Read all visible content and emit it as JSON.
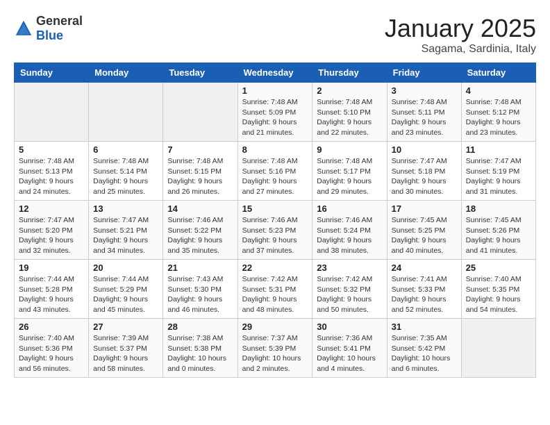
{
  "logo": {
    "text_general": "General",
    "text_blue": "Blue"
  },
  "title": {
    "month": "January 2025",
    "location": "Sagama, Sardinia, Italy"
  },
  "weekdays": [
    "Sunday",
    "Monday",
    "Tuesday",
    "Wednesday",
    "Thursday",
    "Friday",
    "Saturday"
  ],
  "weeks": [
    [
      {
        "day": "",
        "sunrise": "",
        "sunset": "",
        "daylight": ""
      },
      {
        "day": "",
        "sunrise": "",
        "sunset": "",
        "daylight": ""
      },
      {
        "day": "",
        "sunrise": "",
        "sunset": "",
        "daylight": ""
      },
      {
        "day": "1",
        "sunrise": "Sunrise: 7:48 AM",
        "sunset": "Sunset: 5:09 PM",
        "daylight": "Daylight: 9 hours and 21 minutes."
      },
      {
        "day": "2",
        "sunrise": "Sunrise: 7:48 AM",
        "sunset": "Sunset: 5:10 PM",
        "daylight": "Daylight: 9 hours and 22 minutes."
      },
      {
        "day": "3",
        "sunrise": "Sunrise: 7:48 AM",
        "sunset": "Sunset: 5:11 PM",
        "daylight": "Daylight: 9 hours and 23 minutes."
      },
      {
        "day": "4",
        "sunrise": "Sunrise: 7:48 AM",
        "sunset": "Sunset: 5:12 PM",
        "daylight": "Daylight: 9 hours and 23 minutes."
      }
    ],
    [
      {
        "day": "5",
        "sunrise": "Sunrise: 7:48 AM",
        "sunset": "Sunset: 5:13 PM",
        "daylight": "Daylight: 9 hours and 24 minutes."
      },
      {
        "day": "6",
        "sunrise": "Sunrise: 7:48 AM",
        "sunset": "Sunset: 5:14 PM",
        "daylight": "Daylight: 9 hours and 25 minutes."
      },
      {
        "day": "7",
        "sunrise": "Sunrise: 7:48 AM",
        "sunset": "Sunset: 5:15 PM",
        "daylight": "Daylight: 9 hours and 26 minutes."
      },
      {
        "day": "8",
        "sunrise": "Sunrise: 7:48 AM",
        "sunset": "Sunset: 5:16 PM",
        "daylight": "Daylight: 9 hours and 27 minutes."
      },
      {
        "day": "9",
        "sunrise": "Sunrise: 7:48 AM",
        "sunset": "Sunset: 5:17 PM",
        "daylight": "Daylight: 9 hours and 29 minutes."
      },
      {
        "day": "10",
        "sunrise": "Sunrise: 7:47 AM",
        "sunset": "Sunset: 5:18 PM",
        "daylight": "Daylight: 9 hours and 30 minutes."
      },
      {
        "day": "11",
        "sunrise": "Sunrise: 7:47 AM",
        "sunset": "Sunset: 5:19 PM",
        "daylight": "Daylight: 9 hours and 31 minutes."
      }
    ],
    [
      {
        "day": "12",
        "sunrise": "Sunrise: 7:47 AM",
        "sunset": "Sunset: 5:20 PM",
        "daylight": "Daylight: 9 hours and 32 minutes."
      },
      {
        "day": "13",
        "sunrise": "Sunrise: 7:47 AM",
        "sunset": "Sunset: 5:21 PM",
        "daylight": "Daylight: 9 hours and 34 minutes."
      },
      {
        "day": "14",
        "sunrise": "Sunrise: 7:46 AM",
        "sunset": "Sunset: 5:22 PM",
        "daylight": "Daylight: 9 hours and 35 minutes."
      },
      {
        "day": "15",
        "sunrise": "Sunrise: 7:46 AM",
        "sunset": "Sunset: 5:23 PM",
        "daylight": "Daylight: 9 hours and 37 minutes."
      },
      {
        "day": "16",
        "sunrise": "Sunrise: 7:46 AM",
        "sunset": "Sunset: 5:24 PM",
        "daylight": "Daylight: 9 hours and 38 minutes."
      },
      {
        "day": "17",
        "sunrise": "Sunrise: 7:45 AM",
        "sunset": "Sunset: 5:25 PM",
        "daylight": "Daylight: 9 hours and 40 minutes."
      },
      {
        "day": "18",
        "sunrise": "Sunrise: 7:45 AM",
        "sunset": "Sunset: 5:26 PM",
        "daylight": "Daylight: 9 hours and 41 minutes."
      }
    ],
    [
      {
        "day": "19",
        "sunrise": "Sunrise: 7:44 AM",
        "sunset": "Sunset: 5:28 PM",
        "daylight": "Daylight: 9 hours and 43 minutes."
      },
      {
        "day": "20",
        "sunrise": "Sunrise: 7:44 AM",
        "sunset": "Sunset: 5:29 PM",
        "daylight": "Daylight: 9 hours and 45 minutes."
      },
      {
        "day": "21",
        "sunrise": "Sunrise: 7:43 AM",
        "sunset": "Sunset: 5:30 PM",
        "daylight": "Daylight: 9 hours and 46 minutes."
      },
      {
        "day": "22",
        "sunrise": "Sunrise: 7:42 AM",
        "sunset": "Sunset: 5:31 PM",
        "daylight": "Daylight: 9 hours and 48 minutes."
      },
      {
        "day": "23",
        "sunrise": "Sunrise: 7:42 AM",
        "sunset": "Sunset: 5:32 PM",
        "daylight": "Daylight: 9 hours and 50 minutes."
      },
      {
        "day": "24",
        "sunrise": "Sunrise: 7:41 AM",
        "sunset": "Sunset: 5:33 PM",
        "daylight": "Daylight: 9 hours and 52 minutes."
      },
      {
        "day": "25",
        "sunrise": "Sunrise: 7:40 AM",
        "sunset": "Sunset: 5:35 PM",
        "daylight": "Daylight: 9 hours and 54 minutes."
      }
    ],
    [
      {
        "day": "26",
        "sunrise": "Sunrise: 7:40 AM",
        "sunset": "Sunset: 5:36 PM",
        "daylight": "Daylight: 9 hours and 56 minutes."
      },
      {
        "day": "27",
        "sunrise": "Sunrise: 7:39 AM",
        "sunset": "Sunset: 5:37 PM",
        "daylight": "Daylight: 9 hours and 58 minutes."
      },
      {
        "day": "28",
        "sunrise": "Sunrise: 7:38 AM",
        "sunset": "Sunset: 5:38 PM",
        "daylight": "Daylight: 10 hours and 0 minutes."
      },
      {
        "day": "29",
        "sunrise": "Sunrise: 7:37 AM",
        "sunset": "Sunset: 5:39 PM",
        "daylight": "Daylight: 10 hours and 2 minutes."
      },
      {
        "day": "30",
        "sunrise": "Sunrise: 7:36 AM",
        "sunset": "Sunset: 5:41 PM",
        "daylight": "Daylight: 10 hours and 4 minutes."
      },
      {
        "day": "31",
        "sunrise": "Sunrise: 7:35 AM",
        "sunset": "Sunset: 5:42 PM",
        "daylight": "Daylight: 10 hours and 6 minutes."
      },
      {
        "day": "",
        "sunrise": "",
        "sunset": "",
        "daylight": ""
      }
    ]
  ]
}
